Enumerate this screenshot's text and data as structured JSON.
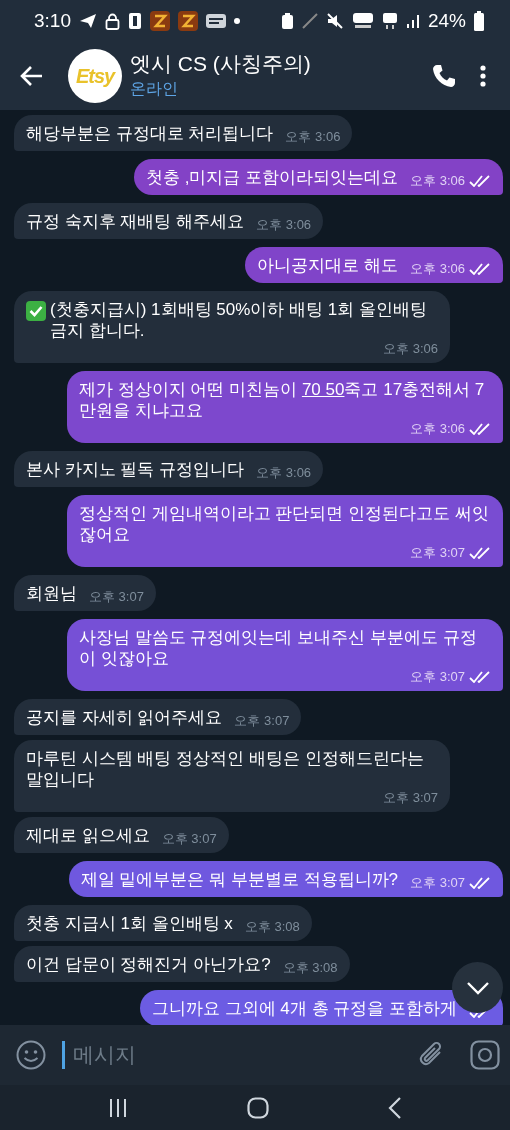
{
  "status_bar": {
    "time": "3:10",
    "battery": "24%"
  },
  "header": {
    "avatar_text": "Etsy",
    "title": "엣시 CS (사칭주의)",
    "status": "온라인"
  },
  "messages": [
    {
      "outgoing": false,
      "kind": "text",
      "text": "해당부분은 규정대로 처리됩니다",
      "time": "오후 3:06"
    },
    {
      "outgoing": true,
      "kind": "text",
      "text": "첫충 ,미지급 포함이라되잇는데요",
      "time": "오후 3:06",
      "read": true
    },
    {
      "outgoing": false,
      "kind": "text",
      "text": "규정 숙지후 재배팅 해주세요",
      "time": "오후 3:06"
    },
    {
      "outgoing": true,
      "kind": "text",
      "text": "아니공지대로 해도",
      "time": "오후 3:06",
      "read": true
    },
    {
      "outgoing": false,
      "kind": "notice",
      "text": "(첫충지급시) 1회배팅 50%이하 배팅 1회 올인배팅 금지 합니다.",
      "time": "오후 3:06"
    },
    {
      "outgoing": true,
      "kind": "text",
      "parts": [
        {
          "kind": "plain",
          "text": "제가 정상이지 어떤 미친놈이 "
        },
        {
          "kind": "link",
          "text": "70 50"
        },
        {
          "kind": "plain",
          "text": "죽고 17충전해서 7만원을 치냐고요"
        }
      ],
      "time": "오후 3:06",
      "read": true
    },
    {
      "outgoing": false,
      "kind": "text",
      "text": "본사 카지노 필독 규정입니다",
      "time": "오후 3:06"
    },
    {
      "outgoing": true,
      "kind": "text",
      "text": "정상적인 게임내역이라고 판단되면 인정된다고도 써잇잖어요",
      "time": "오후 3:07",
      "read": true
    },
    {
      "outgoing": false,
      "kind": "text",
      "text": "회원님",
      "time": "오후 3:07"
    },
    {
      "outgoing": true,
      "kind": "text",
      "text": "사장님 말씀도 규정에잇는데 보내주신 부분에도 규정이 잇잖아요",
      "time": "오후 3:07",
      "read": true
    },
    {
      "outgoing": false,
      "kind": "text",
      "text": "공지를 자세히 읽어주세요",
      "time": "오후 3:07"
    },
    {
      "outgoing": false,
      "kind": "text",
      "text": "마루틴 시스템 배팅 정상적인 배팅은 인정해드린다는 말입니다",
      "time": "오후 3:07"
    },
    {
      "outgoing": false,
      "kind": "text",
      "text": "제대로 읽으세요",
      "time": "오후 3:07"
    },
    {
      "outgoing": true,
      "kind": "text",
      "text": "제일 밑에부분은 뭐 부분별로 적용됩니까?",
      "time": "오후 3:07",
      "read": true
    },
    {
      "outgoing": false,
      "kind": "text",
      "text": "첫충 지급시 1회 올인배팅 x",
      "time": "오후 3:08"
    },
    {
      "outgoing": false,
      "kind": "text",
      "text": "이건 답문이 정해진거 아닌가요?",
      "time": "오후 3:08"
    },
    {
      "outgoing": true,
      "kind": "text",
      "text": "그니까요 그외에 4개 총 규정을 포함하게",
      "read": true
    }
  ],
  "composer": {
    "placeholder": "메시지"
  }
}
